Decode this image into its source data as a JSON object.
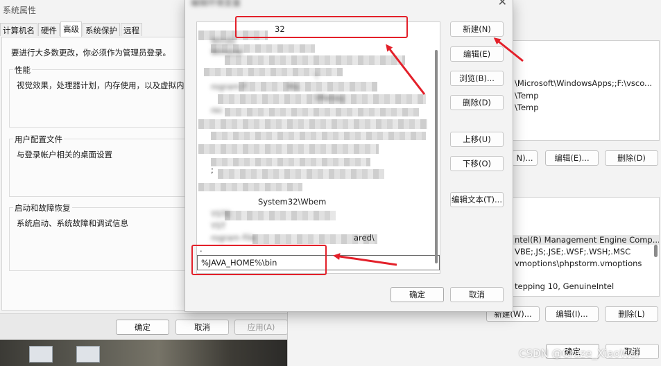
{
  "system_properties": {
    "title": "系统属性",
    "tabs": [
      "计算机名",
      "硬件",
      "高级",
      "系统保护",
      "远程"
    ],
    "active_tab": "高级",
    "admin_note": "要进行大多数更改，你必须作为管理员登录。",
    "groups": [
      {
        "title": "性能",
        "description": "视觉效果，处理器计划，内存使用，以及虚拟内存"
      },
      {
        "title": "用户配置文件",
        "description": "与登录帐户相关的桌面设置"
      },
      {
        "title": "启动和故障恢复",
        "description": "系统启动、系统故障和调试信息"
      }
    ],
    "ok_label": "确定",
    "cancel_label": "取消",
    "apply_label": "应用(A)"
  },
  "env_window": {
    "user_vars_values": [
      "\\Microsoft\\WindowsApps;;F:\\vsco...",
      "\\Temp",
      "\\Temp"
    ],
    "user_buttons": [
      "N)...",
      "编辑(E)...",
      "删除(D)"
    ],
    "system_vars_values": [
      "ntel(R) Management Engine Comp...",
      "VBE;.JS;.JSE;.WSF;.WSH;.MSC",
      "vmoptions\\phpstorm.vmoptions",
      "",
      "tepping 10, GenuineIntel"
    ],
    "system_buttons": [
      "新建(W)...",
      "编辑(I)...",
      "删除(L)"
    ],
    "ok_label": "确定",
    "cancel_label": "取消"
  },
  "edit_dialog": {
    "title": "编辑环境变量",
    "close_glyph": "✕",
    "path_items": [
      "32",
      "Windo",
      "Window",
      "",
      "\\",
      "rogram F",
      "",
      "Ma",
      "\\Manag",
      "rec",
      "",
      "",
      "",
      ";",
      "",
      "",
      "",
      "System32\\Wbem",
      "YSTE",
      "YST",
      "rogram File",
      "ared\\",
      ".",
      "%JAVA_HOME%\\bin"
    ],
    "selected_item": "%JAVA_HOME%\\bin",
    "buttons": {
      "new": "新建(N)",
      "edit": "编辑(E)",
      "browse": "浏览(B)...",
      "delete": "删除(D)",
      "move_up": "上移(U)",
      "move_down": "下移(O)",
      "edit_text": "编辑文本(T)..."
    },
    "ok_label": "确定",
    "cancel_label": "取消"
  },
  "annotation_color": "#e3202a",
  "watermark": "CSDN @Craze_XiaoWei"
}
